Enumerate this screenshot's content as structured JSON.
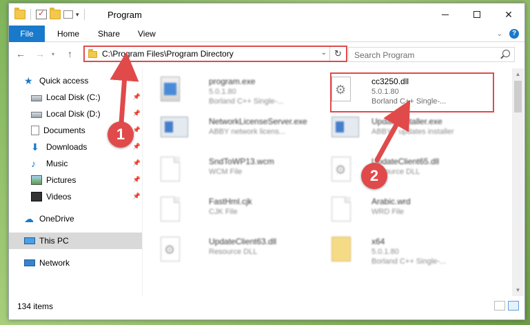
{
  "window": {
    "title": "Program",
    "controls": {
      "minimize": "–",
      "maximize": "□",
      "close": "✕"
    }
  },
  "ribbon": {
    "tabs": [
      "File",
      "Home",
      "Share",
      "View"
    ],
    "help": "?"
  },
  "navigation": {
    "address": "C:\\Program Files\\Program Directory",
    "search_placeholder": "Search Program"
  },
  "sidebar": {
    "items": [
      {
        "label": "Quick access",
        "icon": "star-icon"
      },
      {
        "label": "Local Disk (C:)",
        "icon": "disk-icon",
        "pinned": true
      },
      {
        "label": "Local Disk (D:)",
        "icon": "disk-icon",
        "pinned": true
      },
      {
        "label": "Documents",
        "icon": "documents-icon",
        "pinned": true
      },
      {
        "label": "Downloads",
        "icon": "download-icon",
        "pinned": true
      },
      {
        "label": "Music",
        "icon": "music-icon",
        "pinned": true
      },
      {
        "label": "Pictures",
        "icon": "pictures-icon",
        "pinned": true
      },
      {
        "label": "Videos",
        "icon": "videos-icon",
        "pinned": true
      },
      {
        "label": "OneDrive",
        "icon": "cloud-icon"
      },
      {
        "label": "This PC",
        "icon": "computer-icon",
        "selected": true
      },
      {
        "label": "Network",
        "icon": "network-icon"
      }
    ]
  },
  "files": [
    {
      "name": "program.exe",
      "meta": "5.0.1.80",
      "meta2": "Borland C++ Single-...",
      "icon": "app-icon"
    },
    {
      "name": "cc3250.dll",
      "meta": "5.0.1.80",
      "meta2": "Borland C++ Single-...",
      "icon": "dll-icon",
      "highlighted": true
    },
    {
      "name": "NetworkLicenseServer.exe",
      "meta": "ABBY network licens...",
      "meta2": "",
      "icon": "exe-icon"
    },
    {
      "name": "UpdateInstaller.exe",
      "meta": "ABBYY updates installer",
      "meta2": "",
      "icon": "exe-icon"
    },
    {
      "name": "SndToWP13.wcm",
      "meta": "WCM File",
      "meta2": "",
      "icon": "document-icon"
    },
    {
      "name": "UpdateClient65.dll",
      "meta": "Resource DLL",
      "meta2": "",
      "icon": "dll-icon"
    },
    {
      "name": "FastHml.cjk",
      "meta": "CJK File",
      "meta2": "",
      "icon": "document-icon"
    },
    {
      "name": "Arabic.wrd",
      "meta": "WRD File",
      "meta2": "",
      "icon": "document-icon"
    },
    {
      "name": "UpdateClient63.dll",
      "meta": "Resource DLL",
      "meta2": "",
      "icon": "dll-icon"
    },
    {
      "name": "x64",
      "meta": "5.0.1.80",
      "meta2": "Borland C++ Single-...",
      "icon": "archive-icon"
    }
  ],
  "status": {
    "items_count": "134 items"
  },
  "annotations": {
    "step1": "1",
    "step2": "2",
    "color": "#e04a4a"
  }
}
